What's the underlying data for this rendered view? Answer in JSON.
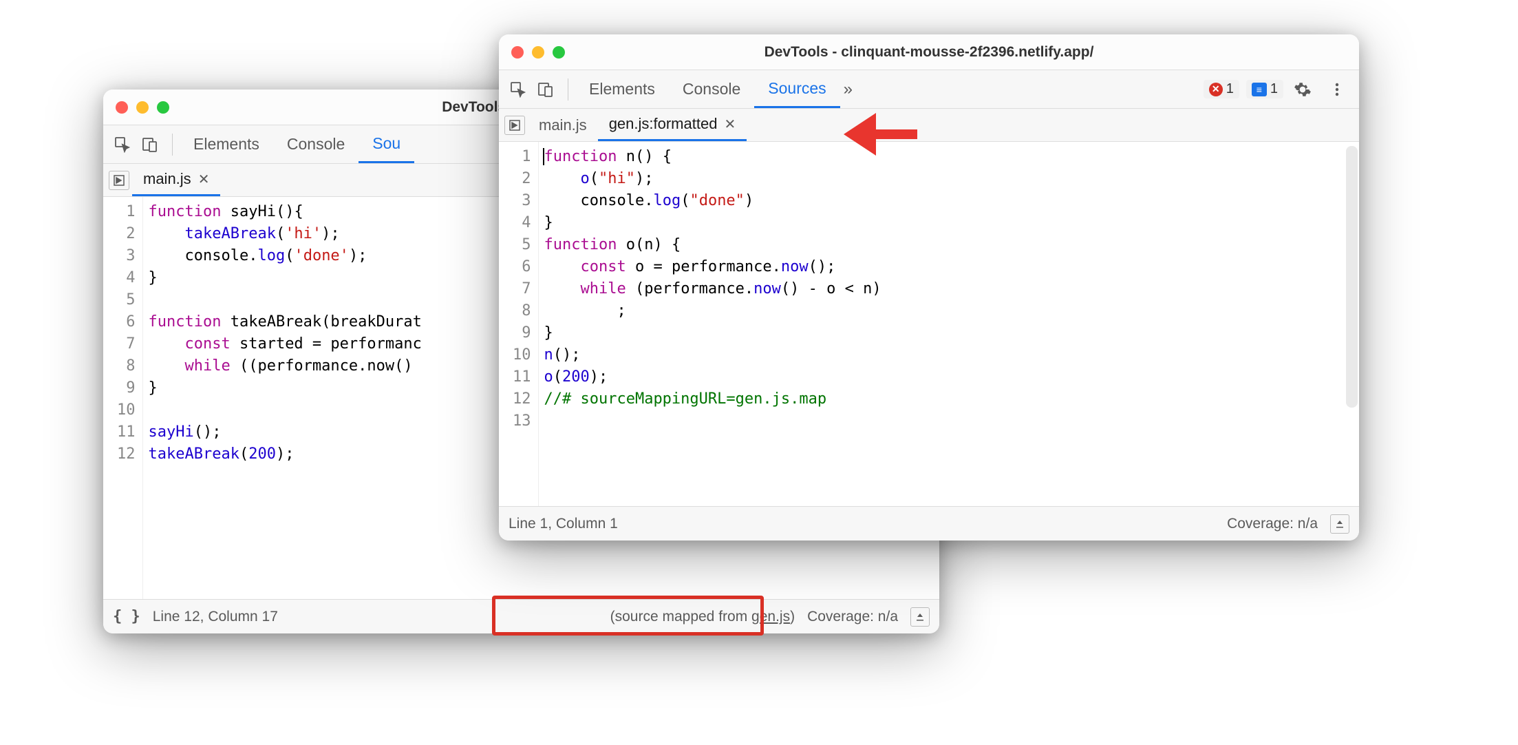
{
  "windowBack": {
    "title": "DevTools - clinquant-m",
    "panels": [
      "Elements",
      "Console",
      "Sou"
    ],
    "activePanel": 2,
    "fileTabs": [
      {
        "name": "main.js",
        "active": true,
        "closable": true
      }
    ],
    "lineNumbers": [
      "1",
      "2",
      "3",
      "4",
      "5",
      "6",
      "7",
      "8",
      "9",
      "10",
      "11",
      "12"
    ],
    "status": {
      "lineCol": "Line 12, Column 17",
      "sourceMapped": "(source mapped from ",
      "sourceMappedLink": "gen.js",
      "sourceMappedEnd": ")",
      "coverage": "Coverage: n/a"
    }
  },
  "windowFront": {
    "title": "DevTools - clinquant-mousse-2f2396.netlify.app/",
    "panels": [
      "Elements",
      "Console",
      "Sources"
    ],
    "activePanel": 2,
    "moreSymbol": "»",
    "errorCount": "1",
    "msgCount": "1",
    "fileTabs": [
      {
        "name": "main.js",
        "active": false,
        "closable": false
      },
      {
        "name": "gen.js:formatted",
        "active": true,
        "closable": true
      }
    ],
    "lineNumbers": [
      "1",
      "2",
      "3",
      "4",
      "5",
      "6",
      "7",
      "8",
      "9",
      "10",
      "11",
      "12",
      "13"
    ],
    "status": {
      "lineCol": "Line 1, Column 1",
      "coverage": "Coverage: n/a"
    }
  },
  "codeBack": {
    "l1": {
      "kw": "function",
      "fn": " sayHi",
      "rest": "(){"
    },
    "l2": {
      "pre": "    ",
      "fn": "takeABreak",
      "p1": "(",
      "str": "'hi'",
      "p2": ");"
    },
    "l3": {
      "pre": "    console.",
      "fn": "log",
      "p1": "(",
      "str": "'done'",
      "p2": ");"
    },
    "l4": "}",
    "l5": "",
    "l6": {
      "kw": "function",
      "fn": " takeABreak",
      "rest": "(breakDurat"
    },
    "l7": {
      "pre": "    ",
      "kw": "const",
      "rest": " started = performanc"
    },
    "l8": {
      "pre": "    ",
      "kw": "while",
      "rest": " ((performance.now() "
    },
    "l9": "}",
    "l10": "",
    "l11": {
      "fn": "sayHi",
      "rest": "();"
    },
    "l12": {
      "fn": "takeABreak",
      "p1": "(",
      "num": "200",
      "p2": ");"
    }
  },
  "codeFront": {
    "l1": {
      "kw": "function",
      "fn": " n",
      "rest": "() {"
    },
    "l2": {
      "pre": "    ",
      "fn": "o",
      "p1": "(",
      "str": "\"hi\"",
      "p2": ");"
    },
    "l3": {
      "pre": "    console.",
      "fn": "log",
      "p1": "(",
      "str": "\"done\"",
      "p2": ")"
    },
    "l4": "}",
    "l5": {
      "kw": "function",
      "fn": " o",
      "rest": "(n) {"
    },
    "l6": {
      "pre": "    ",
      "kw": "const",
      "rest": " o = performance.",
      "fn": "now",
      "tail": "();"
    },
    "l7": {
      "pre": "    ",
      "kw": "while",
      "rest": " (performance.",
      "fn": "now",
      "tail": "() - o < n)"
    },
    "l8": "        ;",
    "l9": "}",
    "l10": {
      "fn": "n",
      "rest": "();"
    },
    "l11": {
      "fn": "o",
      "p1": "(",
      "num": "200",
      "p2": ");"
    },
    "l12": "//# sourceMappingURL=gen.js.map",
    "l13": ""
  }
}
